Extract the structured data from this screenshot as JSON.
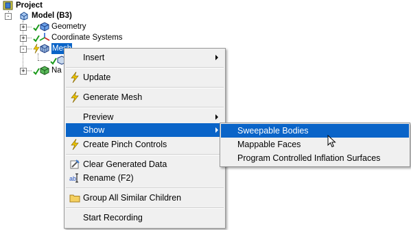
{
  "tree": {
    "project": {
      "label": "Project",
      "icon": "project-icon"
    },
    "model": {
      "label": "Model (B3)",
      "icon": "model-icon",
      "expander": "-"
    },
    "children": [
      {
        "label": "Geometry",
        "icon": "geometry-icon",
        "status": "check",
        "expander": "+"
      },
      {
        "label": "Coordinate Systems",
        "icon": "coordinate-systems-icon",
        "status": "check",
        "expander": "+"
      },
      {
        "label": "Mesh",
        "icon": "mesh-icon",
        "status": "lightning",
        "expander": "-",
        "selected": true
      },
      {
        "label": "Na",
        "icon": "named-selections-icon",
        "status": "check",
        "expander": "+"
      }
    ]
  },
  "context_menu": {
    "items": [
      {
        "label": "Insert",
        "icon": "",
        "submenu": true
      },
      {
        "label": "Update",
        "icon": "lightning-icon",
        "submenu": false
      },
      {
        "label": "Generate Mesh",
        "icon": "lightning-icon",
        "submenu": false
      },
      {
        "label": "Preview",
        "icon": "",
        "submenu": true
      },
      {
        "label": "Show",
        "icon": "",
        "submenu": true,
        "highlighted": true
      },
      {
        "label": "Create Pinch Controls",
        "icon": "lightning-icon",
        "submenu": false
      },
      {
        "label": "Clear Generated Data",
        "icon": "clear-data-icon",
        "submenu": false
      },
      {
        "label": "Rename (F2)",
        "icon": "rename-icon",
        "submenu": false
      },
      {
        "label": "Group All Similar Children",
        "icon": "folder-icon",
        "submenu": false
      },
      {
        "label": "Start Recording",
        "icon": "",
        "submenu": false
      }
    ]
  },
  "submenu": {
    "items": [
      {
        "label": "Sweepable Bodies",
        "highlighted": true
      },
      {
        "label": "Mappable Faces"
      },
      {
        "label": "Program Controlled Inflation Surfaces"
      }
    ]
  },
  "colors": {
    "highlight": "#0a64c8",
    "menu_bg": "#f0f0f0",
    "check": "#1a9a1a",
    "lightning": "#f0c800"
  }
}
